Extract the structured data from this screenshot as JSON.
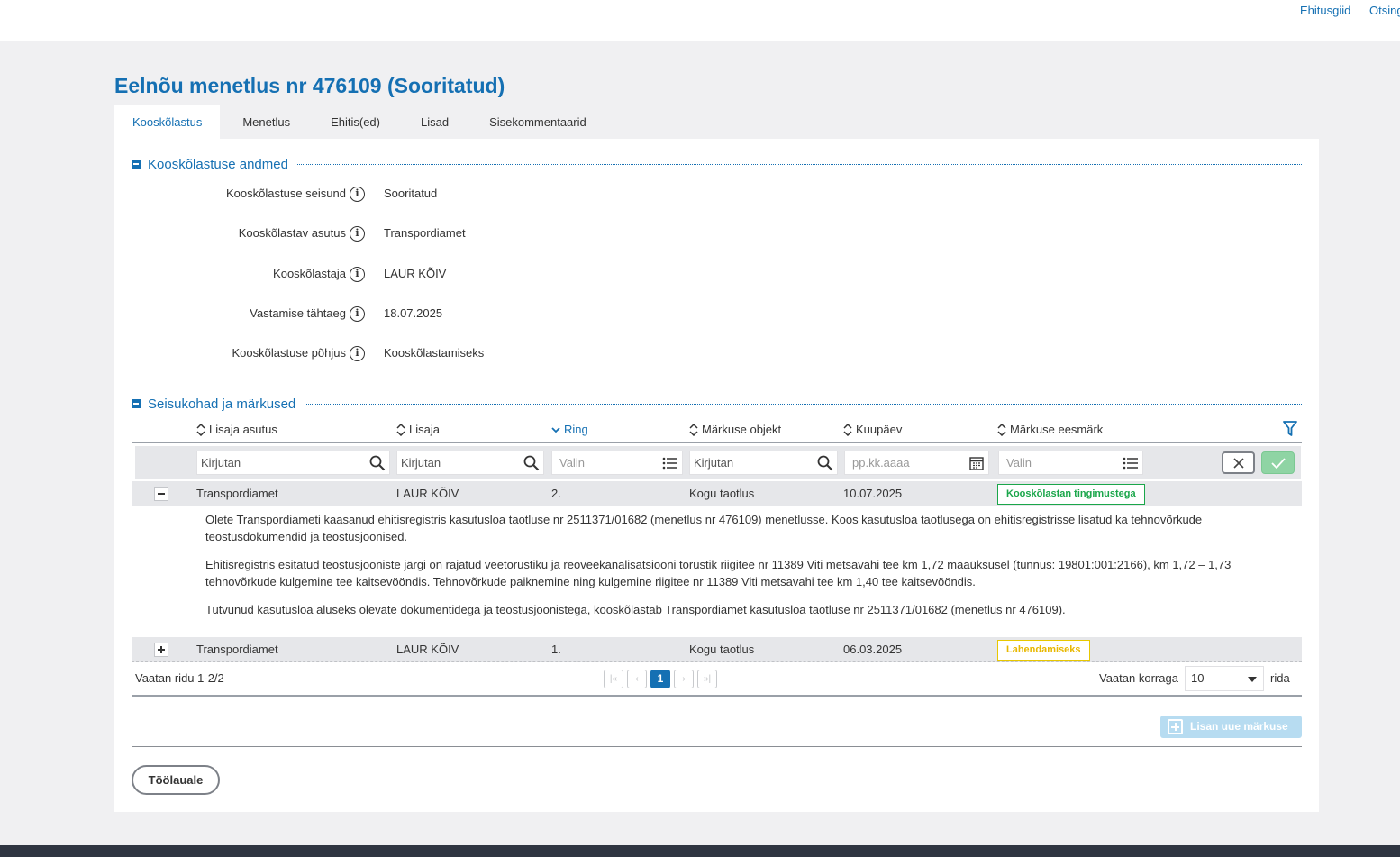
{
  "topbar": {
    "links": [
      "Ehitusgiid",
      "Otsing"
    ]
  },
  "page": {
    "title": "Eelnõu menetlus nr 476109 (Sooritatud)"
  },
  "tabs": [
    {
      "label": "Kooskõlastus",
      "active": true
    },
    {
      "label": "Menetlus",
      "active": false
    },
    {
      "label": "Ehitis(ed)",
      "active": false
    },
    {
      "label": "Lisad",
      "active": false
    },
    {
      "label": "Sisekommentaarid",
      "active": false
    }
  ],
  "details": {
    "section_title": "Kooskõlastuse andmed",
    "fields": [
      {
        "label": "Kooskõlastuse seisund",
        "value": "Sooritatud"
      },
      {
        "label": "Kooskõlastav asutus",
        "value": "Transpordiamet"
      },
      {
        "label": "Kooskõlastaja",
        "value": "LAUR KÕIV"
      },
      {
        "label": "Vastamise tähtaeg",
        "value": "18.07.2025"
      },
      {
        "label": "Kooskõlastuse põhjus",
        "value": "Kooskõlastamiseks"
      }
    ]
  },
  "remarks": {
    "section_title": "Seisukohad ja märkused",
    "columns": [
      "Lisaja asutus",
      "Lisaja",
      "Ring",
      "Märkuse objekt",
      "Kuupäev",
      "Märkuse eesmärk"
    ],
    "sorted_column": "Ring",
    "filters": {
      "lisaja_asutus": "Kirjutan",
      "lisaja": "Kirjutan",
      "ring": "Valin",
      "objekt": "Kirjutan",
      "kuupaev": "pp.kk.aaaa",
      "eesmark": "Valin"
    },
    "rows": [
      {
        "asutus": "Transpordiamet",
        "lisaja": "LAUR KÕIV",
        "ring": "2.",
        "objekt": "Kogu taotlus",
        "kuupaev": "10.07.2025",
        "eesmark": "Kooskõlastan tingimustega",
        "eesmark_color": "#1aa64a",
        "expanded": true,
        "text": [
          "Olete Transpordiameti kaasanud ehitisregistris kasutusloa taotluse nr 2511371/01682 (menetlus nr 476109) menetlusse. Koos kasutusloa taotlusega on ehitisregistrisse lisatud ka tehnovõrkude teostusdokumendid ja teostusjoonised.",
          "Ehitisregistris esitatud teostusjooniste järgi on rajatud veetorustiku ja reoveekanalisatsiooni torustik riigitee nr 11389 Viti metsavahi tee km 1,72 maaüksusel (tunnus: 19801:001:2166), km 1,72 – 1,73 tehnovõrkude kulgemine tee kaitsevööndis. Tehnovõrkude paiknemine ning kulgemine riigitee nr 11389 Viti metsavahi tee km 1,40 tee kaitsevööndis.",
          "Tutvunud kasutusloa aluseks olevate dokumentidega ja teostusjoonistega, kooskõlastab Transpordiamet kasutusloa taotluse nr 2511371/01682 (menetlus nr 476109)."
        ]
      },
      {
        "asutus": "Transpordiamet",
        "lisaja": "LAUR KÕIV",
        "ring": "1.",
        "objekt": "Kogu taotlus",
        "kuupaev": "06.03.2025",
        "eesmark": "Lahendamiseks",
        "eesmark_color": "#e8b800",
        "expanded": false
      }
    ],
    "pager": {
      "summary": "Vaatan ridu 1-2/2",
      "first": "|«",
      "prev": "‹",
      "current_page": "1",
      "next": "›",
      "last": "»|",
      "page_size_label": "Vaatan korraga",
      "page_size": "10",
      "page_size_suffix": "rida"
    },
    "add_button": "Lisan uue märkuse"
  },
  "actions": {
    "back_button": "Töölauale"
  },
  "colors": {
    "primary": "#1570b3",
    "success": "#1aa64a",
    "warning": "#e8b800"
  }
}
